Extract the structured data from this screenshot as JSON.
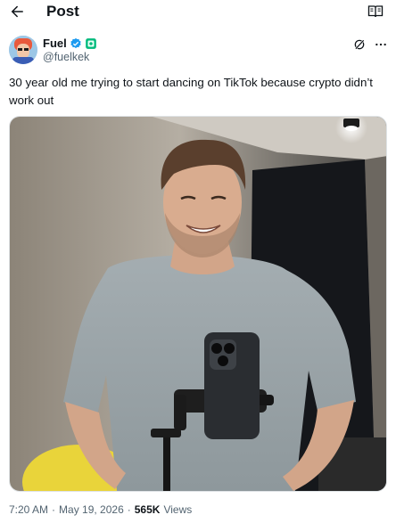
{
  "header": {
    "title": "Post",
    "back_icon": "arrow-left-icon",
    "reader_icon": "book-open-icon"
  },
  "author": {
    "display_name": "Fuel",
    "handle": "@fuelkek",
    "verified_color": "#1d9bf0",
    "affiliate_color": "#00ba7c"
  },
  "tweet": {
    "text": "30 year old me trying to start dancing on TikTok because crypto didn’t work out"
  },
  "meta": {
    "time": "7:20 AM",
    "sep1": "·",
    "date": "May 19, 2026",
    "sep2": "·",
    "views_count": "565K",
    "views_label": "Views"
  },
  "colors": {
    "accent": "#1d9bf0",
    "secondary_text": "#536471"
  }
}
